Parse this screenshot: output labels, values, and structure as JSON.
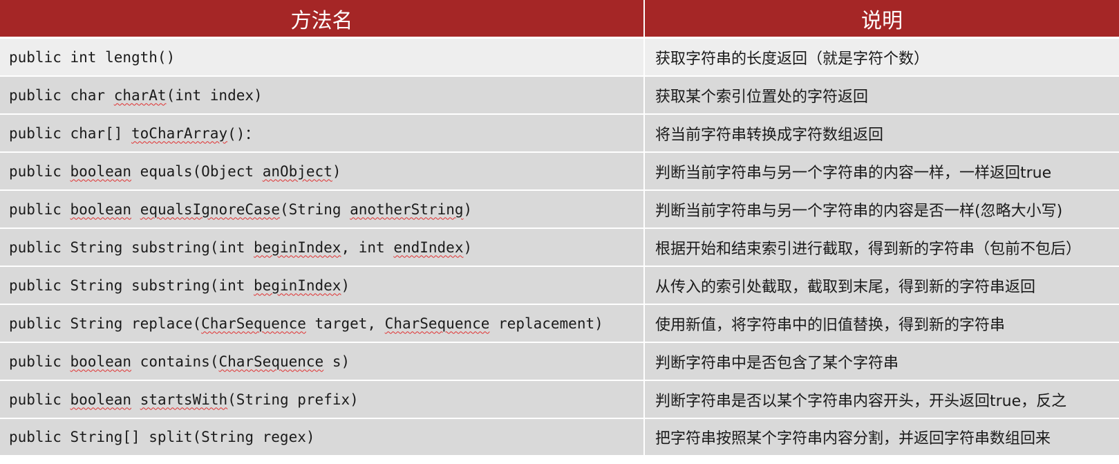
{
  "header": {
    "method_col": "方法名",
    "desc_col": "说明"
  },
  "rows": [
    {
      "method": [
        {
          "t": "public int length()",
          "sq": false
        }
      ],
      "desc": "获取字符串的长度返回（就是字符个数）"
    },
    {
      "method": [
        {
          "t": "public char ",
          "sq": false
        },
        {
          "t": "charAt",
          "sq": true
        },
        {
          "t": "(int index)",
          "sq": false
        }
      ],
      "desc": "获取某个索引位置处的字符返回"
    },
    {
      "method": [
        {
          "t": "public char[] ",
          "sq": false
        },
        {
          "t": "toCharArray",
          "sq": true
        },
        {
          "t": "()：",
          "sq": false
        }
      ],
      "desc": "将当前字符串转换成字符数组返回"
    },
    {
      "method": [
        {
          "t": "public ",
          "sq": false
        },
        {
          "t": "boolean",
          "sq": true
        },
        {
          "t": " equals(Object ",
          "sq": false
        },
        {
          "t": "anObject",
          "sq": true
        },
        {
          "t": ")",
          "sq": false
        }
      ],
      "desc": "判断当前字符串与另一个字符串的内容一样，一样返回true"
    },
    {
      "method": [
        {
          "t": "public ",
          "sq": false
        },
        {
          "t": "boolean",
          "sq": true
        },
        {
          "t": " ",
          "sq": false
        },
        {
          "t": "equalsIgnoreCase",
          "sq": true
        },
        {
          "t": "(String ",
          "sq": false
        },
        {
          "t": "anotherString",
          "sq": true
        },
        {
          "t": ")",
          "sq": false
        }
      ],
      "desc": "判断当前字符串与另一个字符串的内容是否一样(忽略大小写)"
    },
    {
      "method": [
        {
          "t": "public String substring(int ",
          "sq": false
        },
        {
          "t": "beginIndex",
          "sq": true
        },
        {
          "t": ", int ",
          "sq": false
        },
        {
          "t": "endIndex",
          "sq": true
        },
        {
          "t": ")",
          "sq": false
        }
      ],
      "desc": "根据开始和结束索引进行截取，得到新的字符串（包前不包后）"
    },
    {
      "method": [
        {
          "t": "public String substring(int ",
          "sq": false
        },
        {
          "t": "beginIndex",
          "sq": true
        },
        {
          "t": ")",
          "sq": false
        }
      ],
      "desc": "从传入的索引处截取，截取到末尾，得到新的字符串返回"
    },
    {
      "method": [
        {
          "t": "public String replace(",
          "sq": false
        },
        {
          "t": "CharSequence",
          "sq": true
        },
        {
          "t": " target, ",
          "sq": false
        },
        {
          "t": "CharSequence",
          "sq": true
        },
        {
          "t": " replacement)",
          "sq": false
        }
      ],
      "desc": "使用新值，将字符串中的旧值替换，得到新的字符串"
    },
    {
      "method": [
        {
          "t": "public ",
          "sq": false
        },
        {
          "t": "boolean",
          "sq": true
        },
        {
          "t": " contains(",
          "sq": false
        },
        {
          "t": "CharSequence",
          "sq": true
        },
        {
          "t": " s)",
          "sq": false
        }
      ],
      "desc": "判断字符串中是否包含了某个字符串"
    },
    {
      "method": [
        {
          "t": "public ",
          "sq": false
        },
        {
          "t": "boolean",
          "sq": true
        },
        {
          "t": " ",
          "sq": false
        },
        {
          "t": "startsWith",
          "sq": true
        },
        {
          "t": "(String prefix)",
          "sq": false
        }
      ],
      "desc": "判断字符串是否以某个字符串内容开头，开头返回true，反之"
    },
    {
      "method": [
        {
          "t": "public String[] split(String regex)",
          "sq": false
        }
      ],
      "desc": "把字符串按照某个字符串内容分割，并返回字符串数组回来"
    }
  ]
}
